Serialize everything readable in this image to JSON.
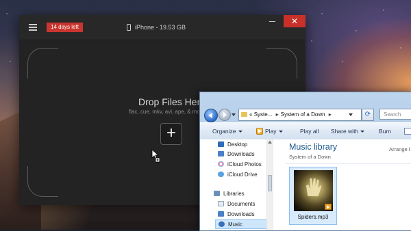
{
  "app_window": {
    "trial_badge": "14 days left",
    "device_label": "iPhone - 19.53 GB",
    "close_glyph": "✕",
    "drop_title": "Drop Files Here",
    "drop_formats": "flac, cue, mkv, avi, ape, & mo",
    "add_glyph": "+"
  },
  "explorer": {
    "address": {
      "prefix": "«",
      "crumbs": [
        "Syste...",
        "System of a Down"
      ],
      "separator": "▸"
    },
    "refresh_glyph": "⟳",
    "search_placeholder": "Search",
    "toolbar": {
      "organize": "Organize",
      "play": "Play",
      "play_all": "Play all",
      "share_with": "Share with",
      "burn": "Burn"
    },
    "nav_items": [
      {
        "label": "Desktop",
        "icon": "desktop-icon"
      },
      {
        "label": "Downloads",
        "icon": "downloads-icon"
      },
      {
        "label": "iCloud Photos",
        "icon": "icloud-photos-icon"
      },
      {
        "label": "iCloud Drive",
        "icon": "icloud-drive-icon"
      },
      {
        "label": "Libraries",
        "icon": "libraries-icon"
      },
      {
        "label": "Documents",
        "icon": "documents-icon"
      },
      {
        "label": "Downloads",
        "icon": "downloads-icon"
      },
      {
        "label": "Music",
        "icon": "music-icon"
      }
    ],
    "library_title": "Music library",
    "library_subtitle": "System of a Down",
    "arrange_label": "Arrange l",
    "file": {
      "name": "Spiders.mp3"
    }
  },
  "colors": {
    "trial_badge": "#c9362f",
    "close_button": "#c8302a",
    "library_title": "#1e5a8c"
  }
}
